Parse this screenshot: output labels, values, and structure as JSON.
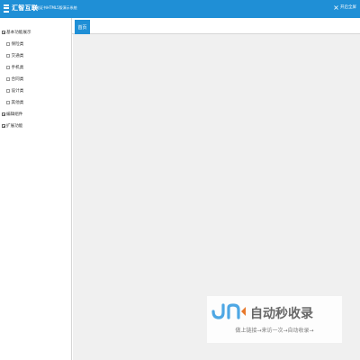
{
  "header": {
    "brand": "汇智互联",
    "subtitle": "智能证书HTML5版演示系统",
    "fullscreen_label": "开启全屏"
  },
  "sidebar": {
    "items": [
      {
        "label": "基本功能展示",
        "level": 0,
        "expanded": true
      },
      {
        "label": "保险类",
        "level": 1
      },
      {
        "label": "交通类",
        "level": 1
      },
      {
        "label": "手机类",
        "level": 1
      },
      {
        "label": "合同类",
        "level": 1
      },
      {
        "label": "设计类",
        "level": 1
      },
      {
        "label": "其他类",
        "level": 1
      },
      {
        "label": "编辑组件",
        "level": 0,
        "expanded": false
      },
      {
        "label": "扩展功能",
        "level": 0,
        "expanded": false
      }
    ]
  },
  "tabs": [
    {
      "label": "首页",
      "active": true
    }
  ],
  "watermark": {
    "title": "自动秒收录",
    "slogan": "做上链接→来访一次→自动收录→"
  },
  "colors": {
    "accent": "#1f8fd6",
    "content_bg": "#f0f0f0"
  }
}
